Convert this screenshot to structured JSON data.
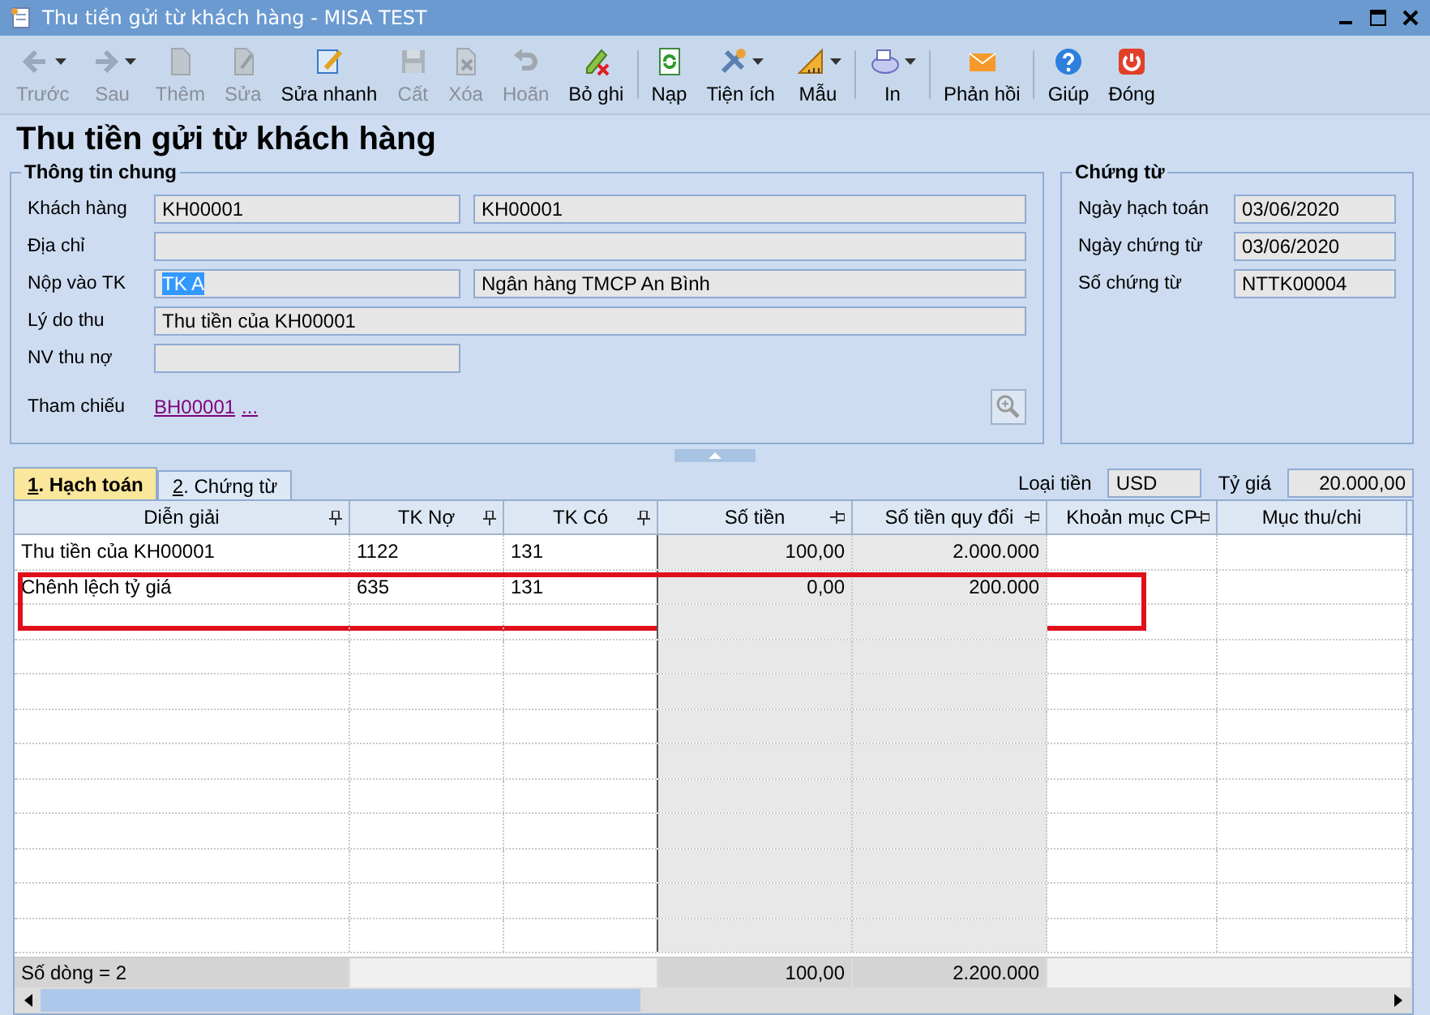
{
  "window": {
    "title": "Thu tiền gửi từ khách hàng - MISA TEST"
  },
  "toolbar": [
    {
      "label": "Trước",
      "disabled": true,
      "dropdown": true
    },
    {
      "label": "Sau",
      "disabled": true,
      "dropdown": true
    },
    {
      "label": "Thêm",
      "disabled": true,
      "dropdown": false
    },
    {
      "label": "Sửa",
      "disabled": true,
      "dropdown": false
    },
    {
      "label": "Sửa nhanh",
      "disabled": false,
      "dropdown": false
    },
    {
      "label": "Cất",
      "disabled": true,
      "dropdown": false
    },
    {
      "label": "Xóa",
      "disabled": true,
      "dropdown": false
    },
    {
      "label": "Hoãn",
      "disabled": true,
      "dropdown": false
    },
    {
      "label": "Bỏ ghi",
      "disabled": false,
      "dropdown": false
    },
    {
      "label": "Nạp",
      "disabled": false,
      "dropdown": false
    },
    {
      "label": "Tiện ích",
      "disabled": false,
      "dropdown": true
    },
    {
      "label": "Mẫu",
      "disabled": false,
      "dropdown": true
    },
    {
      "label": "In",
      "disabled": false,
      "dropdown": true
    },
    {
      "label": "Phản hồi",
      "disabled": false,
      "dropdown": false
    },
    {
      "label": "Giúp",
      "disabled": false,
      "dropdown": false
    },
    {
      "label": "Đóng",
      "disabled": false,
      "dropdown": false
    }
  ],
  "heading": "Thu tiền gửi từ khách hàng",
  "general": {
    "title": "Thông tin chung",
    "customer": {
      "label": "Khách hàng",
      "code": "KH00001",
      "name": "KH00001"
    },
    "address": {
      "label": "Địa chỉ"
    },
    "account": {
      "label": "Nộp vào TK",
      "value": "TK A",
      "bank": "Ngân hàng TMCP An Bình"
    },
    "reason": {
      "label": "Lý do thu",
      "value": "Thu tiền của KH00001"
    },
    "collector": {
      "label": "NV thu nợ"
    },
    "reference": {
      "label": "Tham chiếu",
      "link": "BH00001",
      "more": "..."
    }
  },
  "voucher": {
    "title": "Chứng từ",
    "fields": [
      {
        "label": "Ngày hạch toán",
        "value": "03/06/2020"
      },
      {
        "label": "Ngày chứng từ",
        "value": "03/06/2020"
      },
      {
        "label": "Số chứng từ",
        "value": "NTTK00004"
      }
    ]
  },
  "tabs": [
    {
      "key": "1",
      "label": ". Hạch toán",
      "selected": true
    },
    {
      "key": "2",
      "label": ". Chứng từ",
      "selected": false
    }
  ],
  "currency": {
    "label": "Loại tiền",
    "value": "USD"
  },
  "rate": {
    "label": "Tỷ giá",
    "value": "20.000,00"
  },
  "table": {
    "columns": [
      {
        "label": "Diễn giải",
        "shaded": false
      },
      {
        "label": "TK Nợ",
        "shaded": false
      },
      {
        "label": "TK Có",
        "shaded": false
      },
      {
        "label": "Số tiền",
        "shaded": true
      },
      {
        "label": "Số tiền quy đổi",
        "shaded": true
      },
      {
        "label": "Khoản mục CP",
        "shaded": false
      },
      {
        "label": "Mục thu/chi",
        "shaded": false
      }
    ],
    "rows": [
      {
        "cells": [
          "Thu tiền của KH00001",
          "1122",
          "131",
          "100,00",
          "2.000.000",
          "",
          ""
        ],
        "highlighted": false
      },
      {
        "cells": [
          "Chênh lệch tỷ giá",
          "635",
          "131",
          "0,00",
          "200.000",
          "",
          ""
        ],
        "highlighted": true
      }
    ],
    "footer": {
      "count": "Số dòng = 2",
      "amount": "100,00",
      "converted": "2.200.000"
    }
  }
}
